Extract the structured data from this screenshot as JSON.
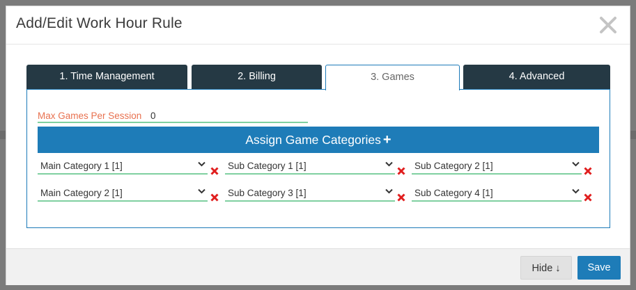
{
  "modal": {
    "title": "Add/Edit Work Hour Rule"
  },
  "tabs": [
    {
      "label": "1. Time Management",
      "active": false
    },
    {
      "label": "2. Billing",
      "active": false
    },
    {
      "label": "3. Games",
      "active": true
    },
    {
      "label": "4. Advanced",
      "active": false
    }
  ],
  "games": {
    "max_games_label": "Max Games Per Session",
    "max_games_value": "0",
    "assign_label": "Assign Game Categories",
    "assign_icon": "plus-icon",
    "categories": [
      {
        "label": "Main Category 1 [1]"
      },
      {
        "label": "Sub Category 1 [1]"
      },
      {
        "label": "Sub Category 2 [1]"
      },
      {
        "label": "Main Category 2 [1]"
      },
      {
        "label": "Sub Category 3 [1]"
      },
      {
        "label": "Sub Category 4 [1]"
      }
    ]
  },
  "footer": {
    "hide_label": "Hide ↓",
    "save_label": "Save"
  },
  "colors": {
    "tab_dark": "#253944",
    "accent_blue": "#1e7cb8",
    "label_orange": "#e8714f",
    "underline_green": "#7fd0a0",
    "remove_red": "#e01e1e"
  }
}
